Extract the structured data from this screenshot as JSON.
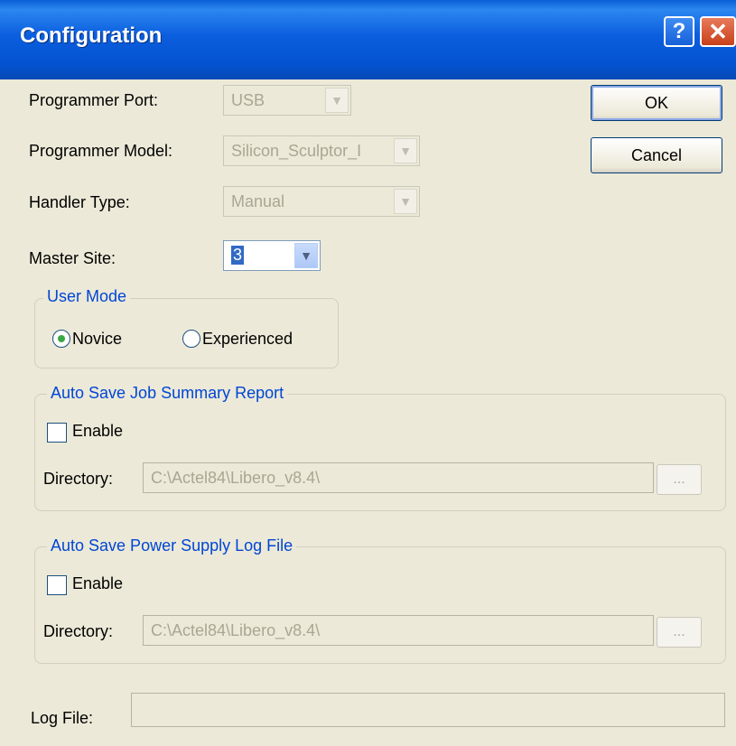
{
  "window": {
    "title": "Configuration",
    "help_label": "?",
    "close_label": "✕"
  },
  "form": {
    "programmer_port": {
      "label": "Programmer Port:",
      "value": "USB"
    },
    "programmer_model": {
      "label": "Programmer Model:",
      "value": "Silicon_Sculptor_I"
    },
    "handler_type": {
      "label": "Handler Type:",
      "value": "Manual"
    },
    "master_site": {
      "label": "Master Site:",
      "value": "3"
    }
  },
  "buttons": {
    "ok": "OK",
    "cancel": "Cancel"
  },
  "user_mode": {
    "legend": "User Mode",
    "options": [
      {
        "label": "Novice",
        "selected": true
      },
      {
        "label": "Experienced",
        "selected": false
      }
    ]
  },
  "job_summary": {
    "legend": "Auto Save Job Summary Report",
    "enable_label": "Enable",
    "enabled": false,
    "directory_label": "Directory:",
    "directory_value": "C:\\Actel84\\Libero_v8.4\\",
    "browse_label": "..."
  },
  "power_log": {
    "legend": "Auto Save Power Supply Log File",
    "enable_label": "Enable",
    "enabled": false,
    "directory_label": "Directory:",
    "directory_value": "C:\\Actel84\\Libero_v8.4\\",
    "browse_label": "..."
  },
  "log_file": {
    "label": "Log File:",
    "value": ""
  },
  "icons": {
    "dropdown": "chevron-down-icon",
    "help": "question-icon",
    "close": "close-icon"
  },
  "colors": {
    "title_bar": "#0b5ede",
    "group_legend": "#0046d5",
    "selection": "#316ac5"
  }
}
